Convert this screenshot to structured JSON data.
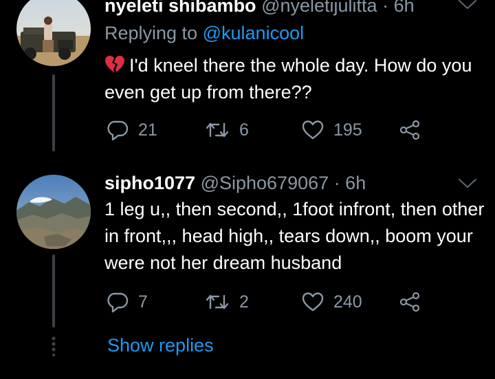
{
  "colors": {
    "background": "#000000",
    "text_primary": "#ffffff",
    "text_secondary": "#8b98a5",
    "accent": "#1d9bf0",
    "thread_line": "#3d4146"
  },
  "tweets": [
    {
      "author_name": "nyeleti shibambo",
      "handle": "@nyeletijulitta",
      "separator": "·",
      "time": "6h",
      "replying_prefix": "Replying to",
      "replying_to": "@kulanicool",
      "emoji_icon": "broken-heart-icon",
      "text": "I'd kneel there the whole day. How do you even get up from there??",
      "actions": {
        "reply_count": "21",
        "retweet_count": "6",
        "like_count": "195"
      }
    },
    {
      "author_name": "sipho1077",
      "handle": "@Sipho679067",
      "separator": "·",
      "time": "6h",
      "text": "1 leg u,, then second,, 1foot infront, then other in front,,, head high,, tears down,, boom your were not her dream husband",
      "actions": {
        "reply_count": "7",
        "retweet_count": "2",
        "like_count": "240"
      }
    }
  ],
  "show_replies_label": "Show replies",
  "icons": [
    "reply-icon",
    "retweet-icon",
    "like-icon",
    "share-icon",
    "chevron-down-icon",
    "broken-heart-icon",
    "more-dots-icon"
  ]
}
